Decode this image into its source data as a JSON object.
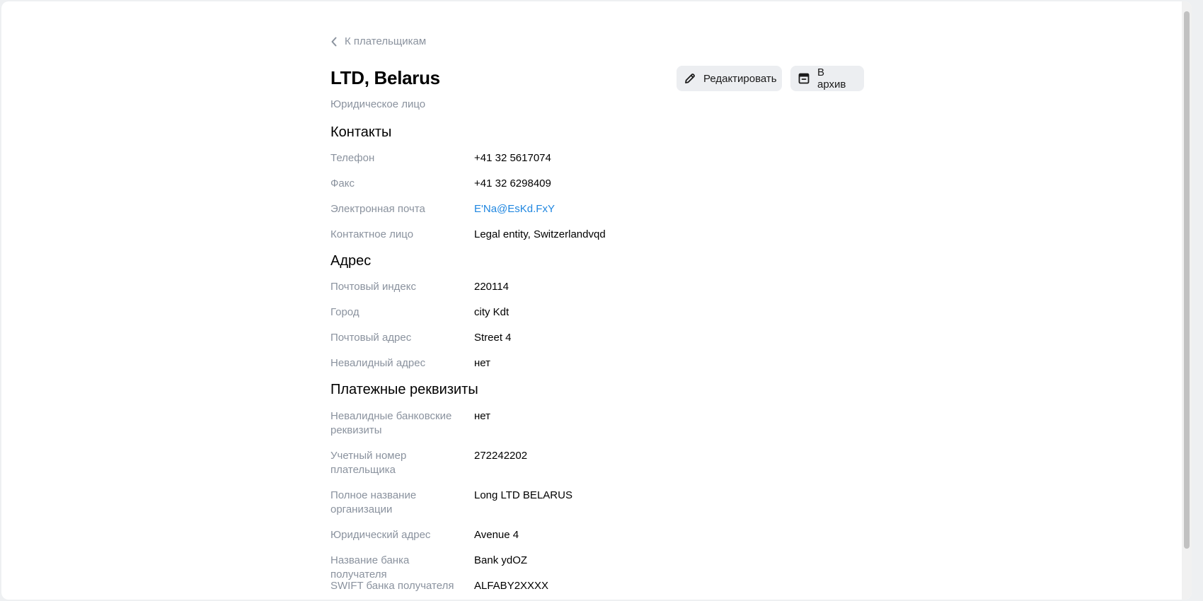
{
  "back_link": {
    "label": "К плательщикам"
  },
  "header": {
    "title": "LTD, Belarus",
    "subtitle": "Юридическое лицо",
    "edit_label": "Редактировать",
    "archive_label": "В архив"
  },
  "contacts": {
    "title": "Контакты",
    "rows": [
      {
        "label": "Телефон",
        "value": "+41 32 5617074"
      },
      {
        "label": "Факс",
        "value": "+41 32 6298409"
      },
      {
        "label": "Электронная почта",
        "value": "E'Na@EsKd.FxY"
      },
      {
        "label": "Контактное лицо",
        "value": "Legal entity, Switzerlandvqd"
      }
    ]
  },
  "address": {
    "title": "Адрес",
    "rows": [
      {
        "label": "Почтовый индекс",
        "value": "220114"
      },
      {
        "label": "Город",
        "value": "city Kdt"
      },
      {
        "label": "Почтовый адрес",
        "value": "Street 4"
      },
      {
        "label": "Невалидный адрес",
        "value": "нет"
      }
    ]
  },
  "payment": {
    "title": "Платежные реквизиты",
    "rows": [
      {
        "label": "Невалидные банковские реквизиты",
        "value": "нет"
      },
      {
        "label": "Учетный номер плательщика",
        "value": "272242202"
      },
      {
        "label": "Полное название организации",
        "value": "Long LTD BELARUS"
      },
      {
        "label": "Юридический адрес",
        "value": "Avenue 4"
      },
      {
        "label": "Название банка получателя",
        "value": "Bank ydOZ"
      },
      {
        "label": "SWIFT банка получателя",
        "value": "ALFABY2XXXX"
      }
    ]
  },
  "colors": {
    "label_gray": "#8a929e",
    "link_blue": "#1f86e0",
    "button_bg": "#eceef1"
  },
  "icons": {
    "back": "chevron-left-icon",
    "edit": "pencil-icon",
    "archive": "archive-box-icon"
  }
}
